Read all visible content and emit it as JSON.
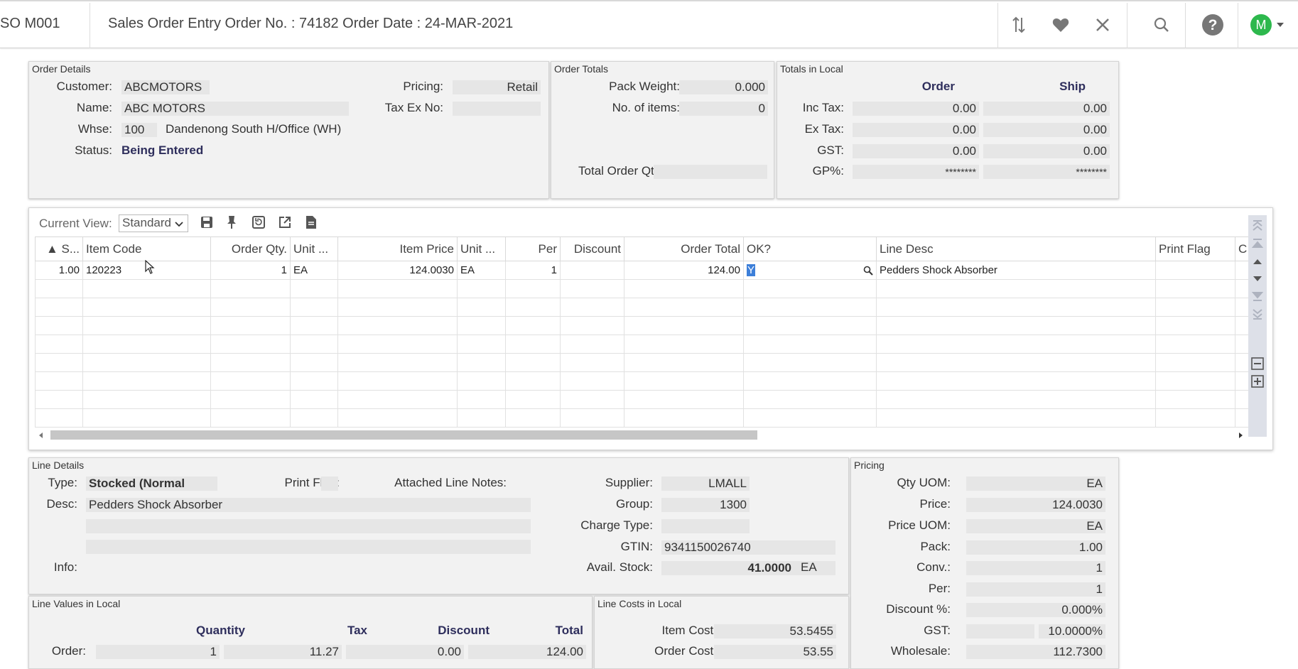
{
  "header": {
    "program": "SO M001",
    "title": "Sales Order Entry Order No. : 74182 Order Date : 24-MAR-2021",
    "avatar_letter": "M"
  },
  "order_details": {
    "title": "Order Details",
    "customer_label": "Customer:",
    "customer": "ABCMOTORS",
    "name_label": "Name:",
    "name": "ABC MOTORS",
    "whse_label": "Whse:",
    "whse_code": "100",
    "whse_name": "Dandenong South H/Office (WH)",
    "status_label": "Status:",
    "status": "Being Entered",
    "pricing_label": "Pricing:",
    "pricing": "Retail",
    "taxex_label": "Tax Ex No:",
    "taxex": ""
  },
  "order_totals": {
    "title": "Order Totals",
    "pack_weight_label": "Pack Weight:",
    "pack_weight": "0.000",
    "items_label": "No. of items:",
    "items": "0",
    "total_qty_label": "Total Order Qty:",
    "total_qty": ""
  },
  "totals_local": {
    "title": "Totals in Local",
    "col_order": "Order",
    "col_ship": "Ship",
    "rows": [
      {
        "label": "Inc Tax:",
        "order": "0.00",
        "ship": "0.00"
      },
      {
        "label": "Ex Tax:",
        "order": "0.00",
        "ship": "0.00"
      },
      {
        "label": "GST:",
        "order": "0.00",
        "ship": "0.00"
      },
      {
        "label": "GP%:",
        "order": "********",
        "ship": "********"
      }
    ]
  },
  "grid": {
    "current_view_label": "Current View:",
    "current_view": "Standard",
    "columns": [
      "▲ S...",
      "Item Code",
      "Order Qty.",
      "Unit ...",
      "Item Price",
      "Unit ...",
      "Per",
      "Discount",
      "Order Total",
      "OK?",
      "Line Desc",
      "Print Flag",
      "C"
    ],
    "rows": [
      [
        "1.00",
        "120223",
        "1",
        "EA",
        "124.0030",
        "EA",
        "1",
        "",
        "124.00",
        "Y",
        "Pedders Shock Absorber",
        "",
        ""
      ]
    ]
  },
  "line_details": {
    "title": "Line Details",
    "type_label": "Type:",
    "type": "Stocked (Normal",
    "print_flag_label": "Print Flag:",
    "print_flag": "",
    "notes_label": "Attached Line Notes:",
    "desc_label": "Desc:",
    "desc": "Pedders Shock Absorber",
    "info_label": "Info:",
    "supplier_label": "Supplier:",
    "supplier": "LMALL",
    "group_label": "Group:",
    "group": "1300",
    "charge_label": "Charge Type:",
    "charge": "",
    "gtin_label": "GTIN:",
    "gtin": "9341150026740",
    "avail_label": "Avail. Stock:",
    "avail": "41.0000",
    "avail_uom": "EA"
  },
  "pricing": {
    "title": "Pricing",
    "rows": [
      {
        "label": "Qty UOM:",
        "value": "EA"
      },
      {
        "label": "Price:",
        "value": "124.0030"
      },
      {
        "label": "Price UOM:",
        "value": "EA"
      },
      {
        "label": "Pack:",
        "value": "1.00"
      },
      {
        "label": "Conv.:",
        "value": "1"
      },
      {
        "label": "Per:",
        "value": "1"
      },
      {
        "label": "Discount %:",
        "value": "0.000%"
      },
      {
        "label": "GST:",
        "value": "10.0000%"
      },
      {
        "label": "Wholesale:",
        "value": "112.7300"
      }
    ]
  },
  "line_values": {
    "title": "Line Values in Local",
    "col_qty": "Quantity",
    "col_tax": "Tax",
    "col_discount": "Discount",
    "col_total": "Total",
    "row_label": "Order:",
    "qty": "1",
    "tax": "11.27",
    "discount": "0.00",
    "total": "124.00"
  },
  "line_costs": {
    "title": "Line Costs in Local",
    "item_cost_label": "Item Cost:",
    "item_cost": "53.5455",
    "order_cost_label": "Order Cost:",
    "order_cost": "53.55"
  },
  "colors": {
    "accent_bold": "#2e2e5c",
    "avatar": "#2db84d",
    "selection": "#3d7fd9"
  }
}
